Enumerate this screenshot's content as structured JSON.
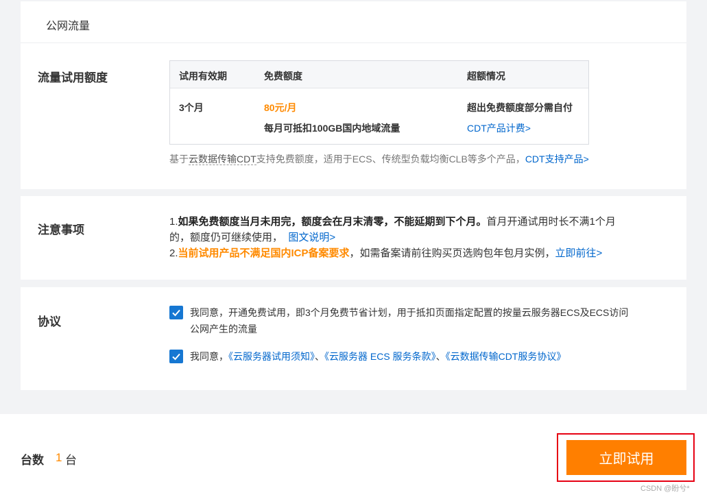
{
  "traffic_section": {
    "subheader": "公网流量",
    "title": "流量试用额度",
    "table": {
      "headers": [
        "试用有效期",
        "免费额度",
        "超额情况"
      ],
      "validity": "3个月",
      "free_amount": "80元/月",
      "free_desc": "每月可抵扣100GB国内地域流量",
      "overage_desc": "超出免费额度部分需自付",
      "overage_link": "CDT产品计费>"
    },
    "note_prefix": "基于",
    "note_product": "云数据传输CDT",
    "note_text": "支持免费额度，适用于ECS、传统型负载均衡CLB等多个产品，",
    "note_link": "CDT支持产品>"
  },
  "notes_section": {
    "title": "注意事项",
    "line1_num": "1.",
    "line1_bold": "如果免费额度当月未用完，额度会在月末清零，不能延期到下个月。",
    "line1_rest": "首月开通试用时长不满1个月",
    "line2_text": "的，额度仍可继续使用，",
    "line2_link": "图文说明>",
    "line3_num": "2.",
    "line3_orange": "当前试用产品不满足国内ICP备案要求",
    "line3_text": "，如需备案请前往购买页选购包年包月实例，",
    "line3_link": "立即前往>"
  },
  "agreement_section": {
    "title": "协议",
    "agree1_line1": "我同意，开通免费试用，即3个月免费节省计划，用于抵扣页面指定配置的按量云服务器ECS及ECS访问",
    "agree1_line2": "公网产生的流量",
    "agree2_prefix": "我同意，",
    "agree2_link1": "《云服务器试用须知》",
    "agree2_sep1": "、",
    "agree2_link2": "《云服务器 ECS 服务条款》",
    "agree2_sep2": "、",
    "agree2_link3": "《云数据传输CDT服务协议》"
  },
  "footer": {
    "qty_label": "台数",
    "qty_value": "1",
    "qty_unit": "台",
    "button_label": "立即试用",
    "watermark": "CSDN @盼兮*"
  },
  "colors": {
    "accent_orange": "#ff7f00",
    "link_blue": "#0066cc",
    "checkbox_blue": "#1677d2",
    "highlight_red": "#e60012"
  }
}
